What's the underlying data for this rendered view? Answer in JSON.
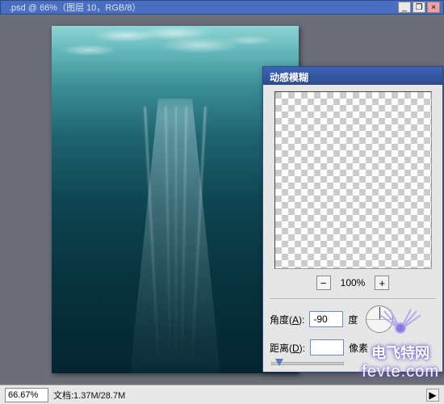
{
  "tab": {
    "title": ".psd @ 66%（图层 10，RGB/8）",
    "minimize": "_",
    "restore": "❐",
    "close": "×"
  },
  "status": {
    "zoom": "66.67%",
    "doc_label": "文档:1.37M/28.7M",
    "arrow": "▶"
  },
  "dialog": {
    "title": "动感模糊",
    "preview_zoom_out": "−",
    "preview_zoom_in": "+",
    "preview_zoom_pct": "100%",
    "angle_label_pre": "角度(",
    "angle_label_key": "A",
    "angle_label_post": "):",
    "angle_value": "-90",
    "angle_unit": "度",
    "distance_label_pre": "距离(",
    "distance_label_key": "D",
    "distance_label_post": "):",
    "distance_value": "",
    "distance_unit": "像素"
  },
  "watermark": {
    "line1": "电飞特网",
    "line2": "fevte.com"
  }
}
